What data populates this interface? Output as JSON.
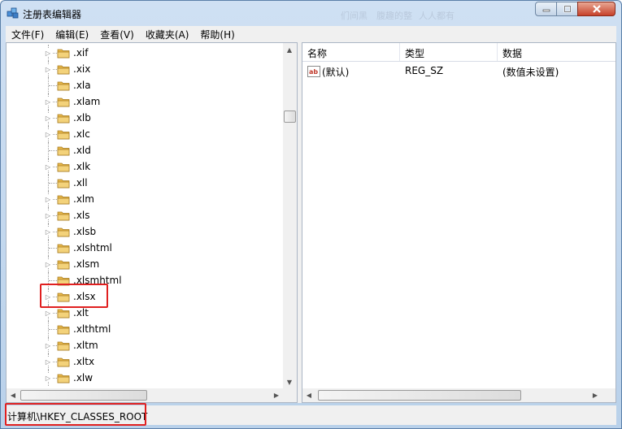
{
  "window": {
    "title": "注册表编辑器",
    "background_ghost_text": [
      "们间黑",
      "腹趣的整",
      "人人都有"
    ],
    "buttons": {
      "minimize": "minimize",
      "maximize": "maximize",
      "close": "close"
    }
  },
  "menubar": {
    "items": [
      {
        "label": "文件(F)"
      },
      {
        "label": "编辑(E)"
      },
      {
        "label": "查看(V)"
      },
      {
        "label": "收藏夹(A)"
      },
      {
        "label": "帮助(H)"
      }
    ]
  },
  "tree": {
    "items": [
      {
        "label": ".xif",
        "expandable": true
      },
      {
        "label": ".xix",
        "expandable": true
      },
      {
        "label": ".xla",
        "expandable": false
      },
      {
        "label": ".xlam",
        "expandable": true
      },
      {
        "label": ".xlb",
        "expandable": true
      },
      {
        "label": ".xlc",
        "expandable": true
      },
      {
        "label": ".xld",
        "expandable": false
      },
      {
        "label": ".xlk",
        "expandable": true
      },
      {
        "label": ".xll",
        "expandable": false
      },
      {
        "label": ".xlm",
        "expandable": true
      },
      {
        "label": ".xls",
        "expandable": true
      },
      {
        "label": ".xlsb",
        "expandable": true
      },
      {
        "label": ".xlshtml",
        "expandable": false
      },
      {
        "label": ".xlsm",
        "expandable": true
      },
      {
        "label": ".xlsmhtml",
        "expandable": false
      },
      {
        "label": ".xlsx",
        "expandable": true,
        "highlighted": true
      },
      {
        "label": ".xlt",
        "expandable": true
      },
      {
        "label": ".xlthtml",
        "expandable": false
      },
      {
        "label": ".xltm",
        "expandable": true
      },
      {
        "label": ".xltx",
        "expandable": true
      },
      {
        "label": ".xlw",
        "expandable": true
      }
    ]
  },
  "list": {
    "columns": [
      "名称",
      "类型",
      "数据"
    ],
    "rows": [
      {
        "name": "(默认)",
        "type": "REG_SZ",
        "data": "(数值未设置)",
        "icon": "string-value-icon"
      }
    ]
  },
  "statusbar": {
    "path": "计算机\\HKEY_CLASSES_ROOT"
  },
  "colors": {
    "highlight": "#e02020",
    "folder": "#e8b84a",
    "title_bar": "#c3d7ee"
  }
}
